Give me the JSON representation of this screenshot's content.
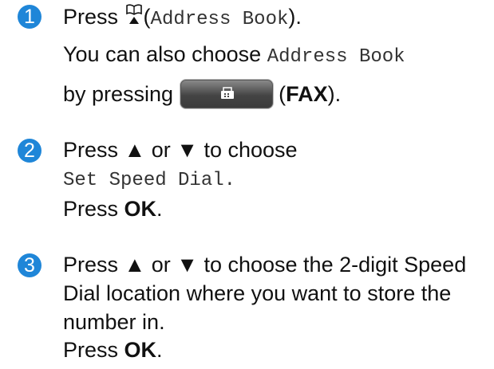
{
  "step1": {
    "number": "1",
    "press_word": "Press",
    "icon": "address-book-icon",
    "paren_open": "(",
    "menu_item": "Address Book",
    "paren_close": ").",
    "line2_text": "You can also choose",
    "line2_item": "Address Book",
    "line3_text": "by pressing",
    "button_icon": "fax-icon",
    "button_label": "FAX",
    "line3_end": ")."
  },
  "step2": {
    "number": "2",
    "instruction": "Press ▲ or ▼ to choose",
    "menu_item": "Set Speed Dial.",
    "press_word": "Press",
    "ok_label": "OK",
    "period": "."
  },
  "step3": {
    "number": "3",
    "line1": "Press ▲ or ▼ to choose the 2-digit Speed",
    "line2": "Dial location where you want to store the",
    "line3": "number in.",
    "press_word": "Press",
    "ok_label": "OK",
    "period": "."
  },
  "colors": {
    "step_badge": "#1f86d8",
    "fax_button": "#444444"
  }
}
